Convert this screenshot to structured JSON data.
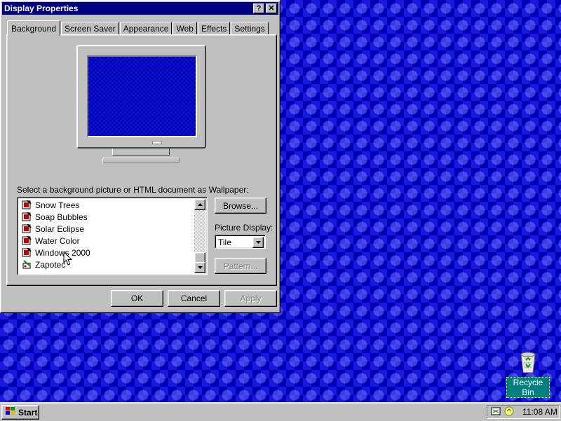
{
  "dialog": {
    "title": "Display Properties",
    "help_glyph": "?",
    "close_glyph": "✕",
    "tabs": [
      "Background",
      "Screen Saver",
      "Appearance",
      "Web",
      "Effects",
      "Settings"
    ],
    "active_tab": "Background",
    "wallpaper_prompt": "Select a background picture or HTML document as Wallpaper:",
    "wallpapers": [
      "Snow Trees",
      "Soap Bubbles",
      "Solar Eclipse",
      "Water Color",
      "Windows 2000",
      "Zapotec"
    ],
    "browse_label": "Browse...",
    "picture_display_label": "Picture Display:",
    "picture_display_value": "Tile",
    "pattern_label": "Pattern...",
    "ok_label": "OK",
    "cancel_label": "Cancel",
    "apply_label": "Apply"
  },
  "desktop": {
    "recycle_bin_label": "Recycle Bin"
  },
  "taskbar": {
    "start_label": "Start",
    "clock": "11:08 AM"
  },
  "colors": {
    "title_bar": "#000080",
    "desktop_blue": "#0000c8",
    "face": "#c0c0c0"
  }
}
